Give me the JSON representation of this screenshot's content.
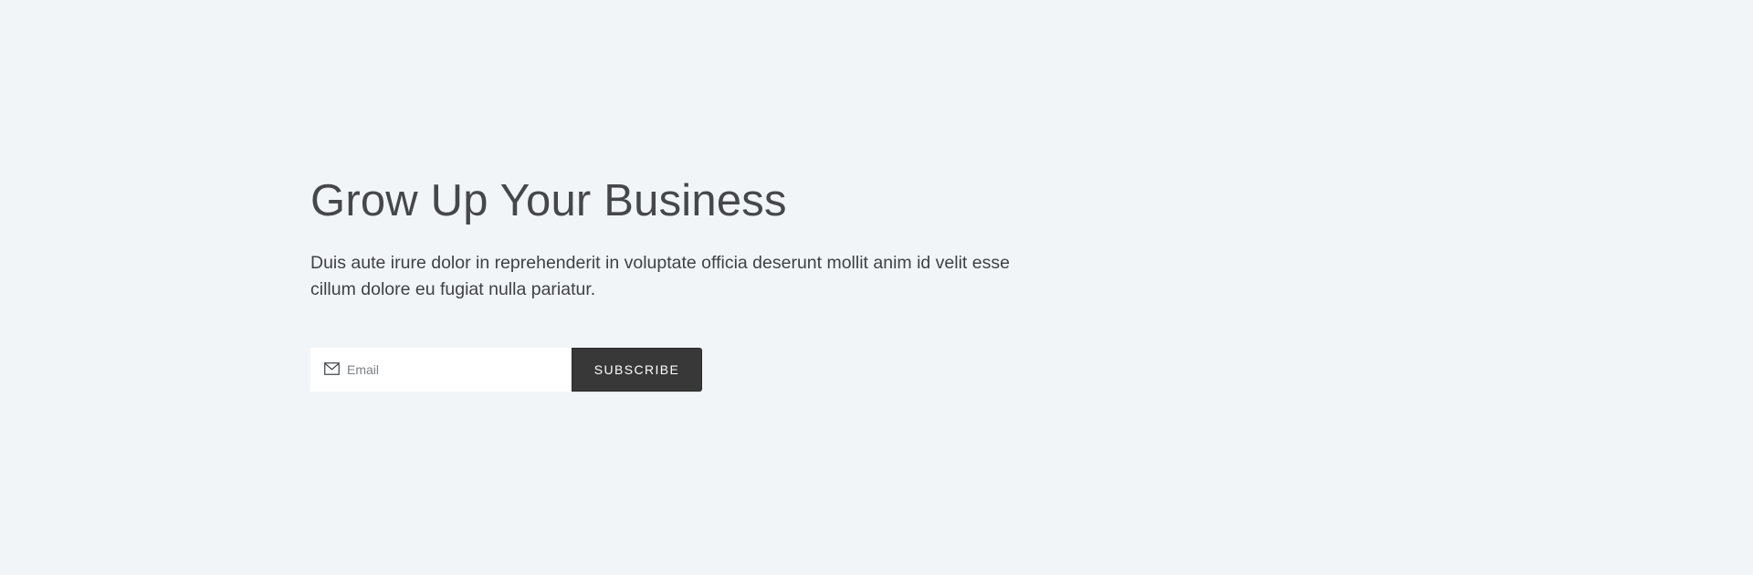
{
  "hero": {
    "title": "Grow Up Your Business",
    "subtitle": "Duis aute irure dolor in reprehenderit in voluptate officia deserunt mollit anim id velit esse cillum dolore eu fugiat nulla pariatur."
  },
  "subscribe_form": {
    "email_placeholder": "Email",
    "email_value": "",
    "email_icon": "mail-icon",
    "button_label": "SUBSCRIBE"
  },
  "colors": {
    "background": "#f2f5f8",
    "button": "#383838",
    "text": "#45474a"
  }
}
